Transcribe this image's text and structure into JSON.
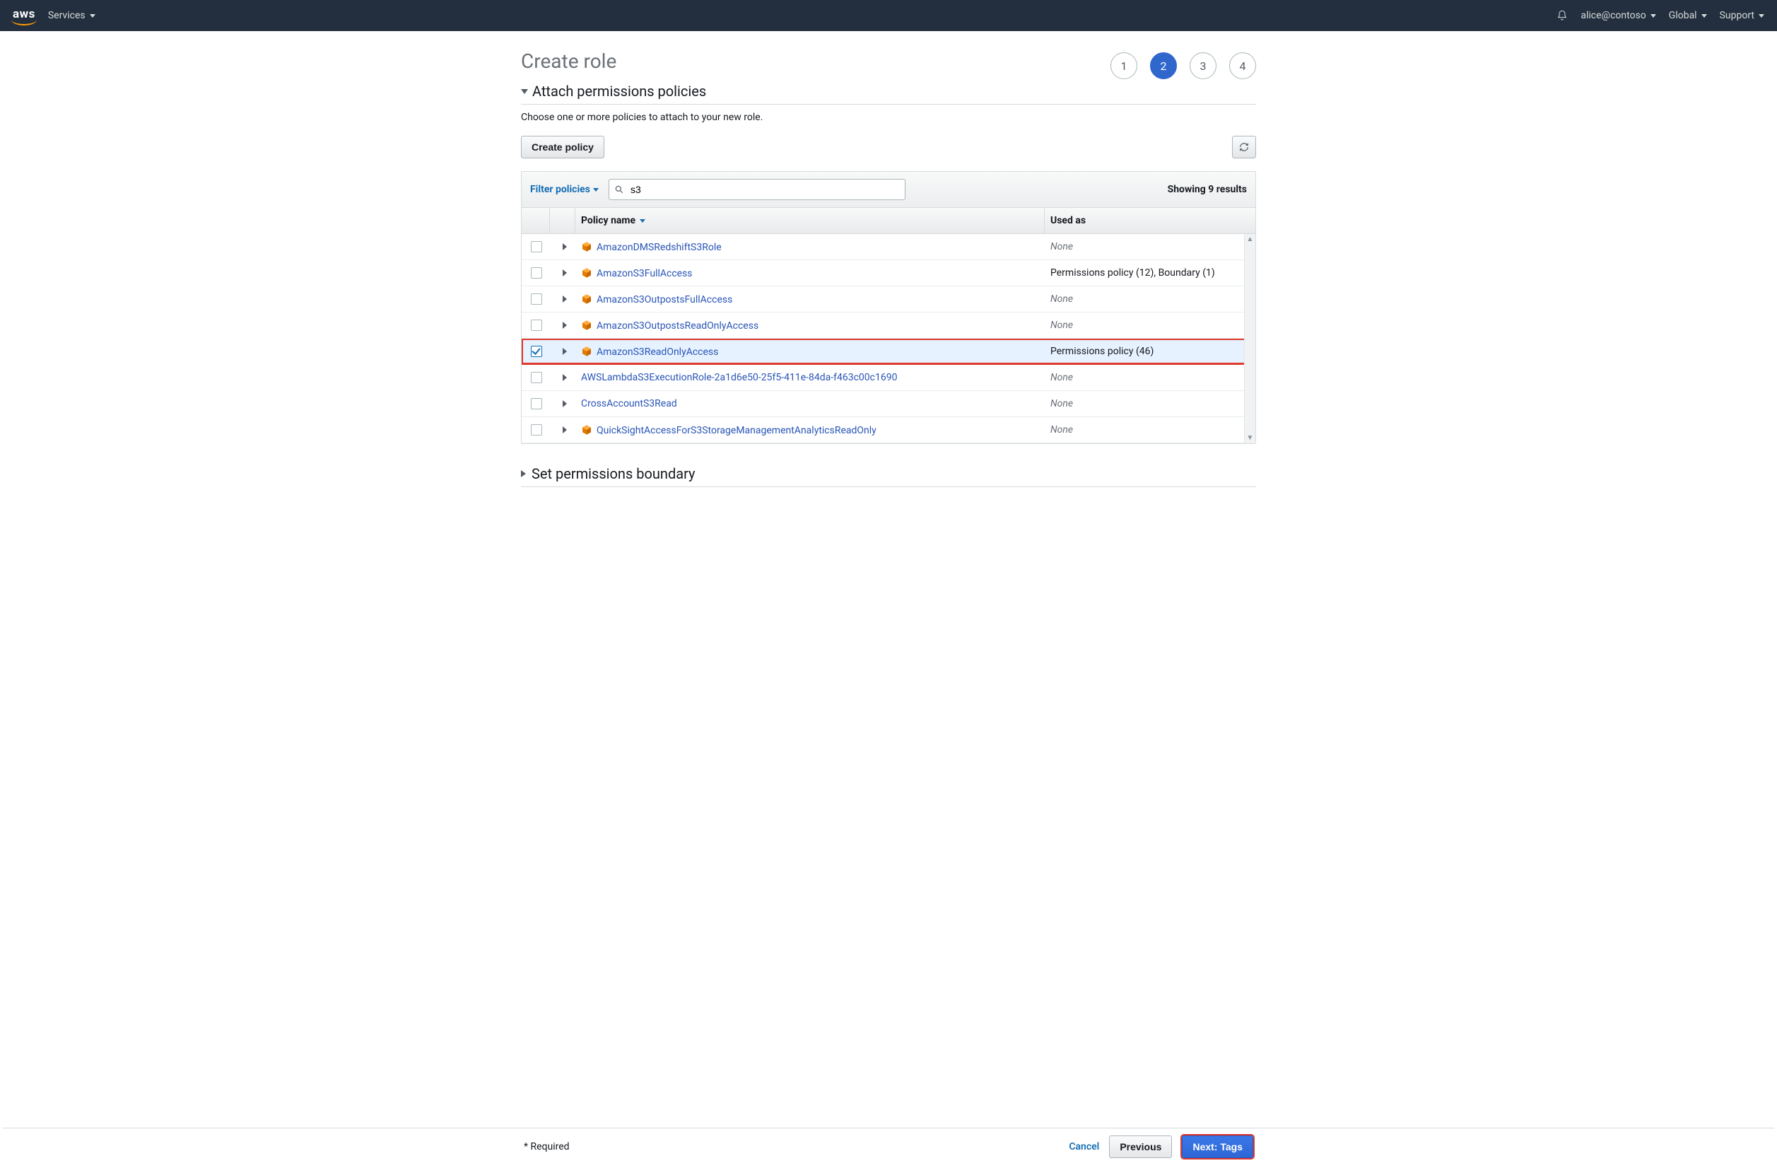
{
  "nav": {
    "services": "Services",
    "user": "alice@contoso",
    "region": "Global",
    "support": "Support"
  },
  "page": {
    "title": "Create role",
    "steps": [
      "1",
      "2",
      "3",
      "4"
    ],
    "active_step_index": 1
  },
  "section": {
    "header": "Attach permissions policies",
    "hint": "Choose one or more policies to attach to your new role.",
    "create_policy_btn": "Create policy",
    "filter_label": "Filter policies",
    "search_value": "s3",
    "results_text": "Showing 9 results",
    "col_policy": "Policy name",
    "col_used": "Used as"
  },
  "policies": [
    {
      "name": "AmazonDMSRedshiftS3Role",
      "used_as": "None",
      "managed": true,
      "checked": false
    },
    {
      "name": "AmazonS3FullAccess",
      "used_as": "Permissions policy (12), Boundary (1)",
      "managed": true,
      "checked": false
    },
    {
      "name": "AmazonS3OutpostsFullAccess",
      "used_as": "None",
      "managed": true,
      "checked": false
    },
    {
      "name": "AmazonS3OutpostsReadOnlyAccess",
      "used_as": "None",
      "managed": true,
      "checked": false
    },
    {
      "name": "AmazonS3ReadOnlyAccess",
      "used_as": "Permissions policy (46)",
      "managed": true,
      "checked": true,
      "highlight": true
    },
    {
      "name": "AWSLambdaS3ExecutionRole-2a1d6e50-25f5-411e-84da-f463c00c1690",
      "used_as": "None",
      "managed": false,
      "checked": false
    },
    {
      "name": "CrossAccountS3Read",
      "used_as": "None",
      "managed": false,
      "checked": false
    },
    {
      "name": "QuickSightAccessForS3StorageManagementAnalyticsReadOnly",
      "used_as": "None",
      "managed": true,
      "checked": false
    }
  ],
  "boundary": {
    "header": "Set permissions boundary"
  },
  "footer": {
    "required": "* Required",
    "cancel": "Cancel",
    "previous": "Previous",
    "next": "Next: Tags"
  }
}
